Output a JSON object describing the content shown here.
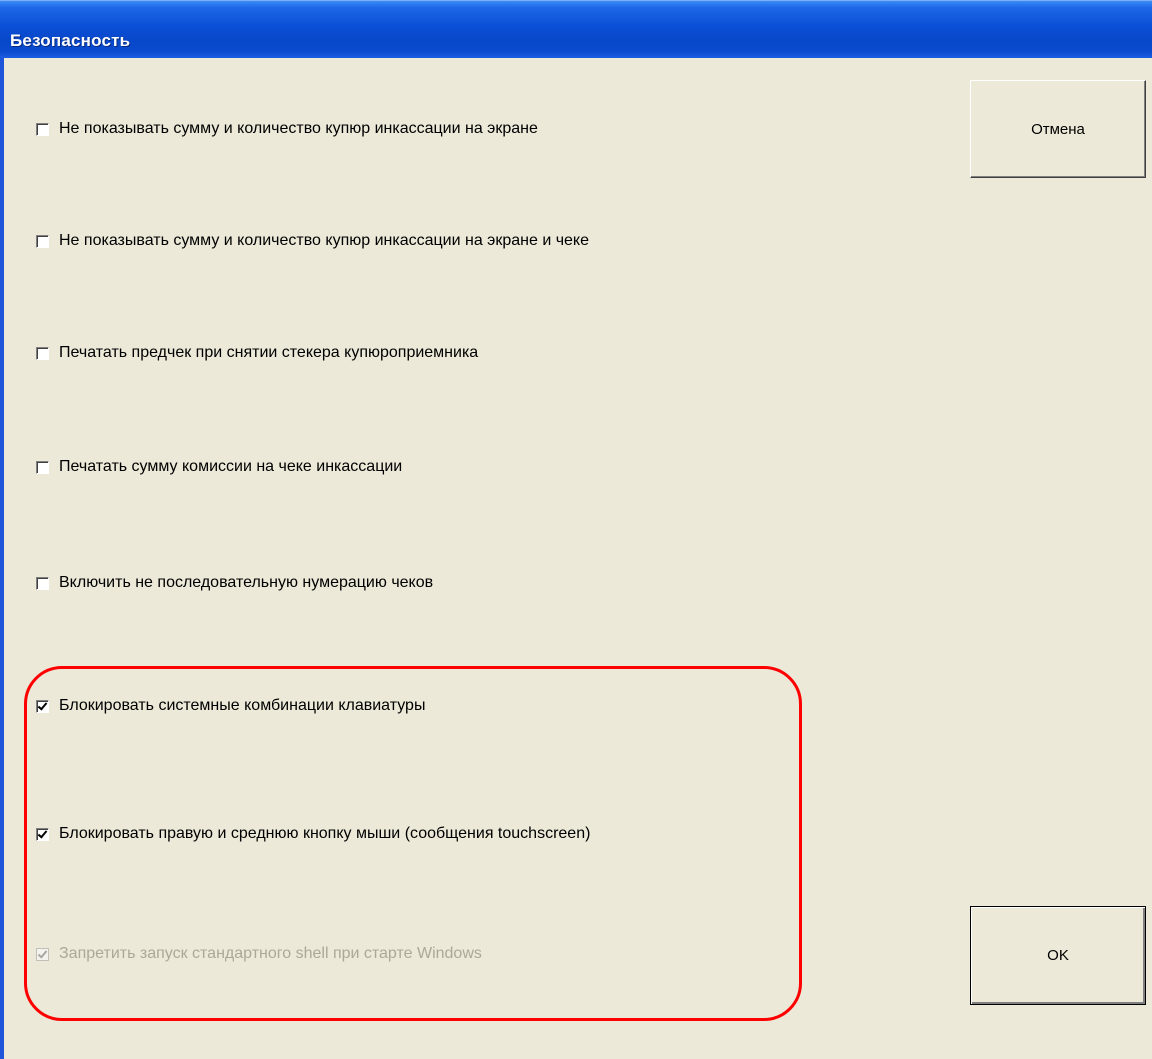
{
  "window": {
    "title": "Безопасность"
  },
  "options": [
    {
      "label": "Не показывать сумму и количество купюр инкассации на экране",
      "checked": false,
      "disabled": false
    },
    {
      "label": "Не показывать сумму и количество купюр инкассации на экране и чеке",
      "checked": false,
      "disabled": false
    },
    {
      "label": "Печатать предчек при снятии стекера купюроприемника",
      "checked": false,
      "disabled": false
    },
    {
      "label": "Печатать сумму комиссии на чеке инкассации",
      "checked": false,
      "disabled": false
    },
    {
      "label": "Включить не последовательную нумерацию чеков",
      "checked": false,
      "disabled": false
    },
    {
      "label": "Блокировать системные комбинации клавиатуры",
      "checked": true,
      "disabled": false
    },
    {
      "label": "Блокировать правую и среднюю кнопку мыши (сообщения touchscreen)",
      "checked": true,
      "disabled": false
    },
    {
      "label": "Запретить запуск стандартного shell при старте Windows",
      "checked": true,
      "disabled": true
    }
  ],
  "buttons": {
    "cancel_label": "Отмена",
    "ok_label": "OK"
  },
  "colors": {
    "titlebar": "#0a4fd6",
    "window_bg": "#ece9d8",
    "annotation": "#ff0000",
    "disabled_text": "#aca899"
  }
}
